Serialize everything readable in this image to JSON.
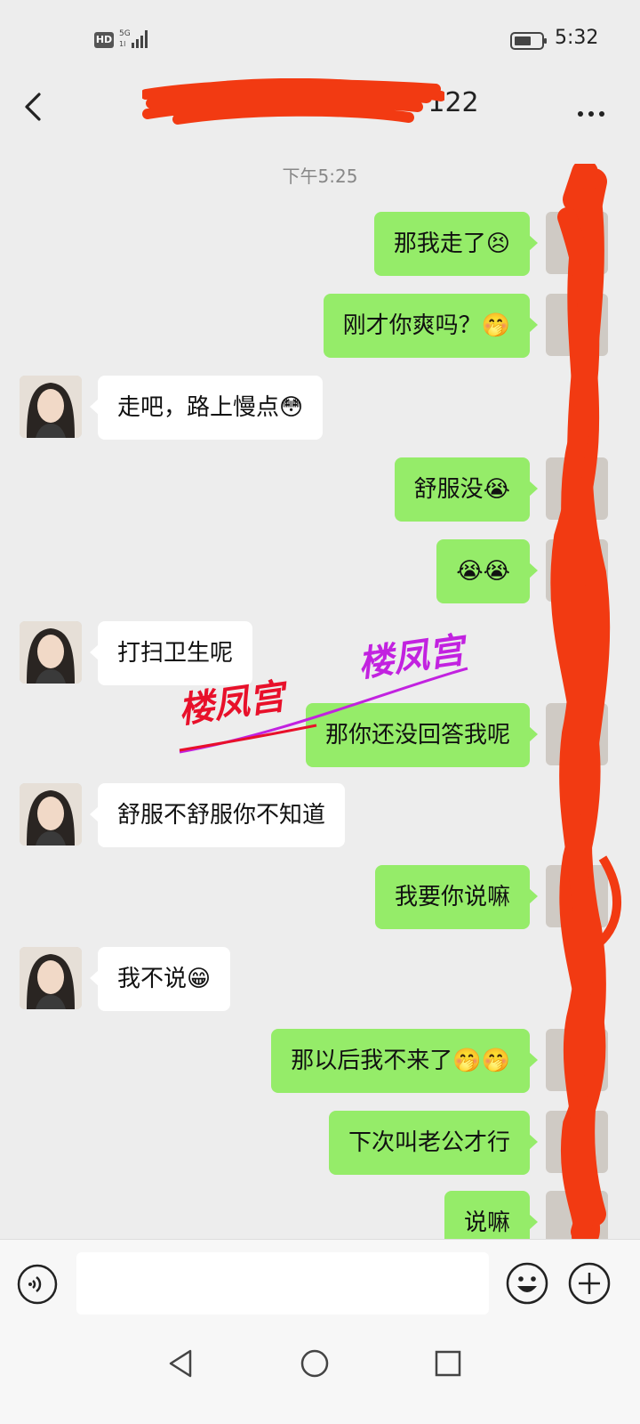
{
  "status_bar": {
    "hd": "HD",
    "network": "5G",
    "time": "5:32"
  },
  "header": {
    "title": "122"
  },
  "chat": {
    "timestamp": "下午5:25",
    "messages": [
      {
        "side": "right",
        "text": "那我走了",
        "emoji": "😣"
      },
      {
        "side": "right",
        "text": "刚才你爽吗？",
        "emoji": "🤭"
      },
      {
        "side": "left",
        "text": "走吧，路上慢点",
        "emoji": "😳"
      },
      {
        "side": "right",
        "text": "舒服没",
        "emoji": "😭"
      },
      {
        "side": "right",
        "text": "",
        "emoji": "😭😭"
      },
      {
        "side": "left",
        "text": "打扫卫生呢",
        "emoji": ""
      },
      {
        "side": "right",
        "text": "那你还没回答我呢",
        "emoji": ""
      },
      {
        "side": "left",
        "text": "舒服不舒服你不知道",
        "emoji": ""
      },
      {
        "side": "right",
        "text": "我要你说嘛",
        "emoji": ""
      },
      {
        "side": "left",
        "text": "我不说",
        "emoji": "😁"
      },
      {
        "side": "right",
        "text": "那以后我不来了",
        "emoji": "🤭🤭"
      },
      {
        "side": "right",
        "text": "下次叫老公才行",
        "emoji": ""
      },
      {
        "side": "right",
        "text": "说嘛",
        "emoji": ""
      }
    ]
  },
  "watermarks": [
    "楼凤宫",
    "楼凤宫"
  ],
  "input_bar": {
    "placeholder": ""
  },
  "colors": {
    "background": "#ededed",
    "my_bubble": "#95ec69",
    "their_bubble": "#ffffff",
    "redaction": "#f23a12",
    "watermark_red": "#e8102a",
    "watermark_purple": "#c222e0"
  },
  "icons": [
    "back-icon",
    "more-icon",
    "voice-icon",
    "emoji-icon",
    "plus-icon",
    "nav-back-icon",
    "nav-home-icon",
    "nav-recent-icon"
  ]
}
